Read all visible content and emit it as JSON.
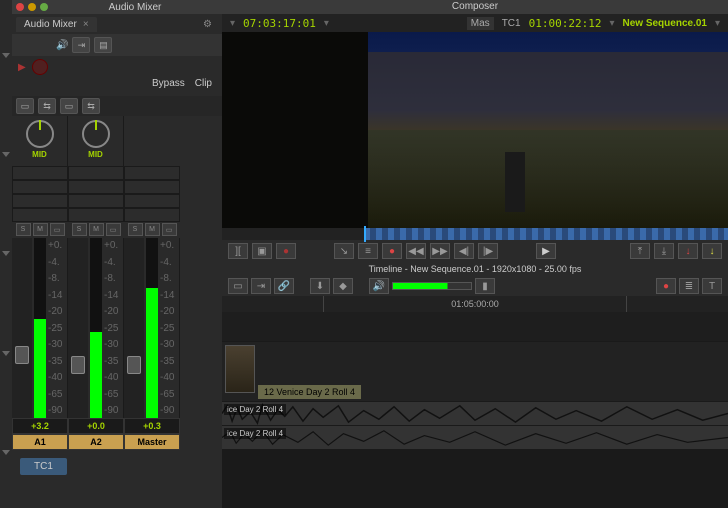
{
  "mixer": {
    "window_title": "Audio Mixer",
    "tab_label": "Audio Mixer",
    "bypass_label": "Bypass",
    "clip_label": "Clip",
    "knob_label": "MID",
    "scale": [
      "+0.",
      "-4.",
      "-8.",
      "-14",
      "-20",
      "-25",
      "-30",
      "-35",
      "-40",
      "-65",
      "-90"
    ],
    "channels": [
      {
        "name": "A1",
        "value": "+3.2",
        "level": 55,
        "fader": 108
      },
      {
        "name": "A2",
        "value": "+0.0",
        "level": 48,
        "fader": 118
      },
      {
        "name": "Master",
        "value": "+0.3",
        "level": 72,
        "fader": 118
      }
    ],
    "tc_chip": "TC1"
  },
  "composer": {
    "title": "Composer",
    "src_tc": "07:03:17:01",
    "mas_label": "Mas",
    "tc_track": "TC1",
    "rec_tc": "01:00:22:12",
    "seq_name": "New Sequence.01"
  },
  "timeline": {
    "title": "Timeline - New Sequence.01 - 1920x1080 - 25.00 fps",
    "ruler": "01:05:00:00",
    "video_clip": "12 Venice Day 2 Roll 4",
    "audio_clip": "ice Day 2 Roll 4"
  }
}
